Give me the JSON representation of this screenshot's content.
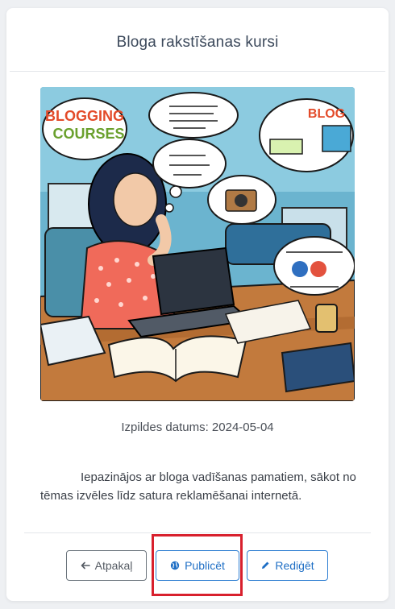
{
  "page": {
    "title": "Bloga rakstīšanas kursi",
    "image_alt": "Blogging courses illustration",
    "image_lettering": [
      "BLOGGING COURSES",
      "BLOG"
    ],
    "date_text": "Izpildes datums: 2024-05-04",
    "description": "Iepazinājos ar bloga vadīšanas pamatiem, sākot no tēmas izvēles līdz satura reklamēšanai internetā."
  },
  "actions": {
    "back_label": "Atpakaļ",
    "publish_label": "Publicēt",
    "edit_label": "Rediģēt",
    "back_icon": "arrow-left-icon",
    "publish_icon": "globe-icon",
    "edit_icon": "pencil-icon"
  },
  "colors": {
    "primary": "#1f6fc5",
    "secondary": "#6c757d",
    "highlight": "#d8202d"
  }
}
